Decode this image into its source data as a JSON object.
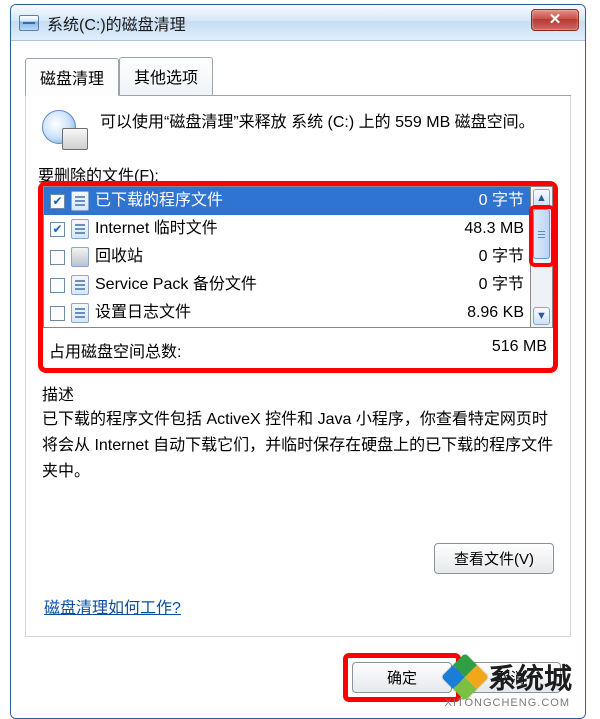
{
  "window": {
    "title": "系统(C:)的磁盘清理"
  },
  "tabs": {
    "cleanup": "磁盘清理",
    "other": "其他选项"
  },
  "intro": "可以使用“磁盘清理”来释放 系统 (C:) 上的 559 MB 磁盘空间。",
  "files_label_partial": "要删除的文件(F):",
  "file_list": [
    {
      "checked": true,
      "selected": true,
      "icon": "doc",
      "name": "已下载的程序文件",
      "size": "0 字节"
    },
    {
      "checked": true,
      "selected": false,
      "icon": "doc",
      "name": "Internet 临时文件",
      "size": "48.3 MB"
    },
    {
      "checked": false,
      "selected": false,
      "icon": "bin",
      "name": "回收站",
      "size": "0 字节"
    },
    {
      "checked": false,
      "selected": false,
      "icon": "doc",
      "name": "Service Pack 备份文件",
      "size": "0 字节"
    },
    {
      "checked": false,
      "selected": false,
      "icon": "doc",
      "name": "设置日志文件",
      "size": "8.96 KB"
    }
  ],
  "total": {
    "label": "占用磁盘空间总数:",
    "value": "516 MB"
  },
  "desc_label_partial": "描述",
  "description": "已下载的程序文件包括 ActiveX 控件和 Java 小程序，你查看特定网页时将会从 Internet 自动下载它们，并临时保存在硬盘上的已下载的程序文件夹中。",
  "view_files_btn": "查看文件(V)",
  "help_link": "磁盘清理如何工作?",
  "ok_btn": "确定",
  "cancel_btn": "取消",
  "watermark": {
    "brand": "系统城",
    "url": "XITONGCHENG.COM"
  }
}
